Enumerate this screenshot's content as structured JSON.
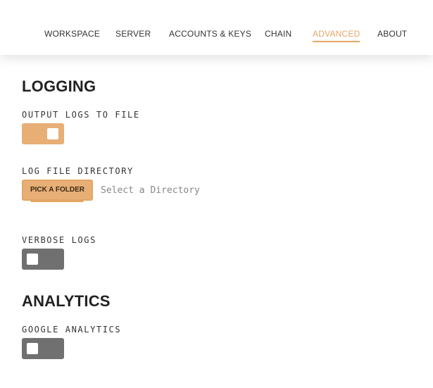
{
  "nav": {
    "tabs": [
      {
        "label": "WORKSPACE"
      },
      {
        "label": "SERVER"
      },
      {
        "label": "ACCOUNTS & KEYS"
      },
      {
        "label": "CHAIN"
      },
      {
        "label": "ADVANCED"
      },
      {
        "label": "ABOUT"
      }
    ],
    "active_tab": "ADVANCED"
  },
  "logging": {
    "title": "LOGGING",
    "output_logs": {
      "label": "OUTPUT LOGS TO FILE",
      "enabled": true
    },
    "log_directory": {
      "label": "LOG FILE DIRECTORY",
      "button_label": "PICK A FOLDER",
      "placeholder": "Select a Directory"
    },
    "verbose_logs": {
      "label": "VERBOSE LOGS",
      "enabled": false
    }
  },
  "analytics": {
    "title": "ANALYTICS",
    "google_analytics": {
      "label": "GOOGLE ANALYTICS",
      "enabled": false
    }
  },
  "colors": {
    "accent": "#e4a663",
    "toggle_on": "#e7ae76",
    "toggle_off": "#707070"
  }
}
